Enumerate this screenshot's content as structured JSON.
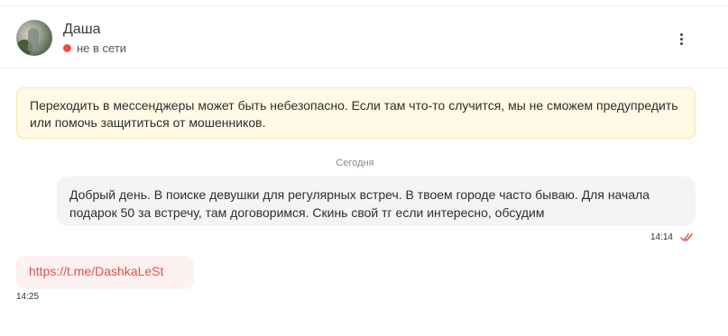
{
  "contact": {
    "name": "Даша",
    "status": "не в сети",
    "status_color": "#ef4b4b"
  },
  "header": {
    "menu_icon": "more-vertical-icon"
  },
  "warning": {
    "text": "Переходить в мессенджеры может быть небезопасно. Если там что-то случится, мы не сможем предупредить или помочь защититься от мошенников.",
    "background": "#fff9e5"
  },
  "chat": {
    "date_label": "Сегодня",
    "messages": [
      {
        "direction": "outgoing",
        "text": "Добрый день. В поиске девушки для регулярных встреч. В твоем городе часто бываю. Для начала подарок 50 за встречу, там договоримся. Скинь свой тг если интересно, обсудим",
        "time": "14:14",
        "read_icon": "double-check-icon"
      },
      {
        "direction": "incoming",
        "text": "https://t.me/DashkaLeSt",
        "time": "14:25",
        "link_color": "#e0514f"
      }
    ]
  }
}
